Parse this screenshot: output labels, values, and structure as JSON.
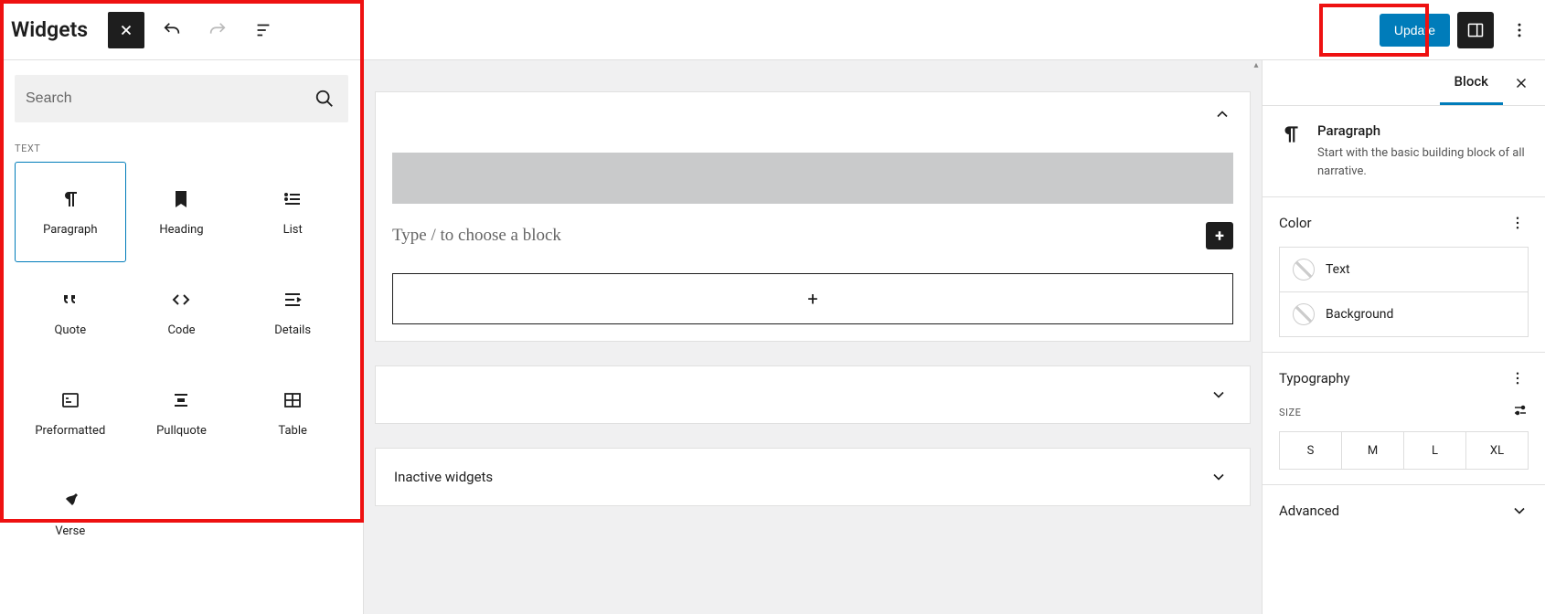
{
  "topbar": {
    "title": "Widgets",
    "update_label": "Update"
  },
  "inserter": {
    "search_placeholder": "Search",
    "category_label": "TEXT",
    "blocks": [
      {
        "label": "Paragraph",
        "icon": "paragraph",
        "selected": true
      },
      {
        "label": "Heading",
        "icon": "bookmark",
        "selected": false
      },
      {
        "label": "List",
        "icon": "list",
        "selected": false
      },
      {
        "label": "Quote",
        "icon": "quote",
        "selected": false
      },
      {
        "label": "Code",
        "icon": "code",
        "selected": false
      },
      {
        "label": "Details",
        "icon": "details",
        "selected": false
      },
      {
        "label": "Preformatted",
        "icon": "preformatted",
        "selected": false
      },
      {
        "label": "Pullquote",
        "icon": "pullquote",
        "selected": false
      },
      {
        "label": "Table",
        "icon": "table",
        "selected": false
      },
      {
        "label": "Verse",
        "icon": "verse",
        "selected": false
      }
    ]
  },
  "canvas": {
    "paragraph_placeholder": "Type / to choose a block",
    "inactive_label": "Inactive widgets"
  },
  "settings": {
    "tab_label": "Block",
    "block_name": "Paragraph",
    "block_desc": "Start with the basic building block of all narrative.",
    "color_panel": "Color",
    "color_text": "Text",
    "color_bg": "Background",
    "typo_panel": "Typography",
    "size_label": "SIZE",
    "sizes": [
      "S",
      "M",
      "L",
      "XL"
    ],
    "advanced_panel": "Advanced"
  }
}
